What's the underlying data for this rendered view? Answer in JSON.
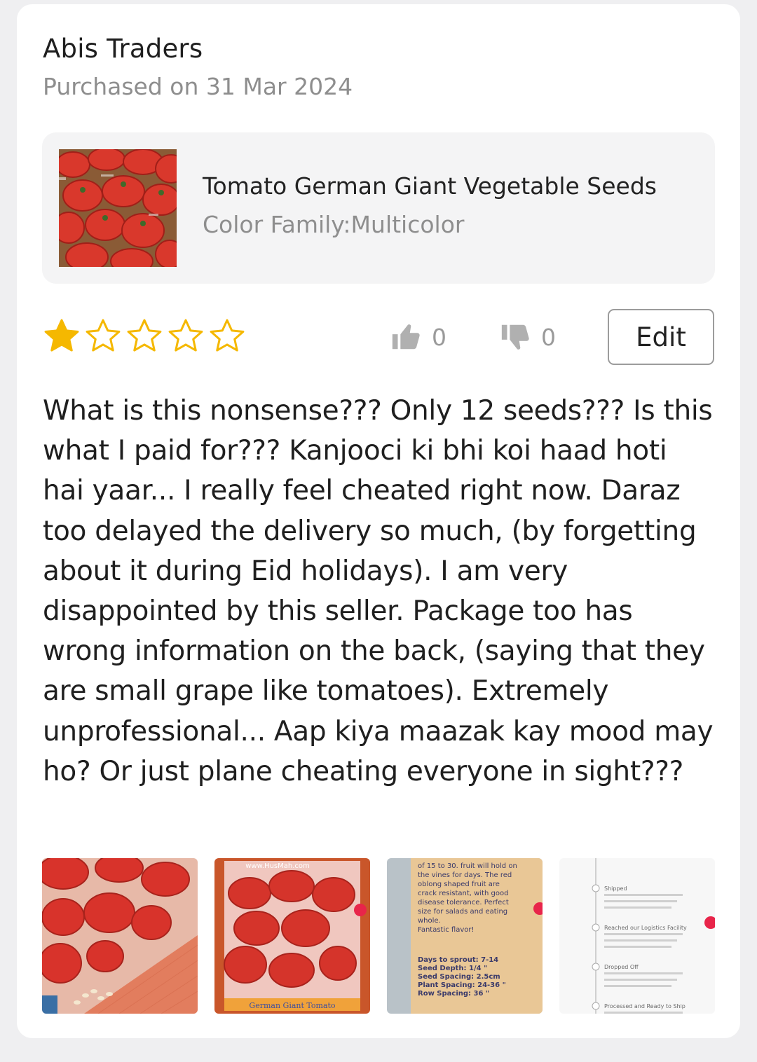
{
  "review": {
    "seller_name": "Abis Traders",
    "purchase_date": "Purchased on 31 Mar 2024",
    "product": {
      "name": "Tomato German Giant Vegetable Seeds",
      "variant": "Color Family:Multicolor",
      "thumbnail_icon": "tomatoes-photo"
    },
    "rating": 1,
    "rating_max": 5,
    "star_color": "#f5b800",
    "helpful_count": "0",
    "not_helpful_count": "0",
    "edit_label": "Edit",
    "text": "What is this nonsense??? Only 12 seeds??? Is this what I paid for??? Kanjooci ki bhi koi haad hoti hai yaar... I really feel cheated right now. Daraz too delayed the delivery so much, (by forgetting about it during Eid holidays). I am very disappointed by this seller. Package too has wrong information on the back, (saying that they are small grape like tomatoes). Extremely unprofessional... Aap kiya maazak kay mood may ho? Or just plane cheating everyone in sight???",
    "photos": [
      {
        "icon": "seed-packet-front-photo"
      },
      {
        "icon": "seed-packet-full-photo",
        "watermark": "www.HusMah.com",
        "packet_title": "German Giant Tomato"
      },
      {
        "icon": "seed-packet-back-photo",
        "lines": [
          "of 15 to 30. fruit will hold on",
          "the vines for days. The red",
          "oblong shaped fruit are",
          "crack resistant, with good",
          "disease tolerance. Perfect",
          "size for salads and eating",
          "whole.",
          "Fantastic flavor!"
        ],
        "specs": [
          "Days to sprout: 7-14",
          "Seed Depth: 1/4 \"",
          "Seed Spacing: 2.5cm",
          "Plant Spacing: 24-36 \"",
          "Row Spacing: 36 \""
        ]
      },
      {
        "icon": "delivery-tracking-screenshot",
        "steps": [
          "Shipped",
          "Reached our Logistics Facility",
          "Dropped Off",
          "Processed and Ready to Ship"
        ]
      }
    ]
  }
}
